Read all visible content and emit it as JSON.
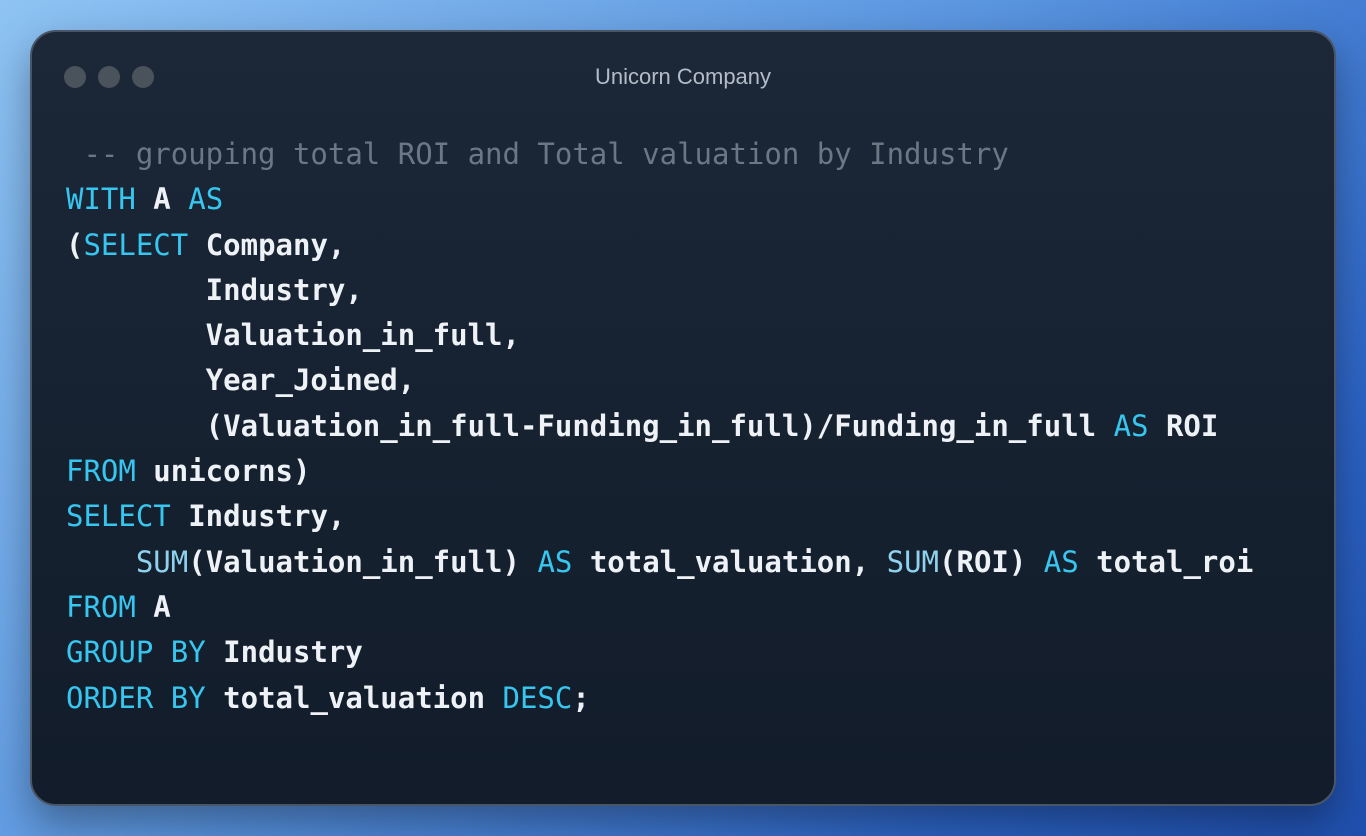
{
  "window": {
    "title": "Unicorn Company",
    "controls": [
      "close-dot",
      "minimize-dot",
      "zoom-dot"
    ]
  },
  "colors": {
    "keyword": "#36c6ef",
    "function": "#8fd2ee",
    "comment": "#6c7784",
    "identifier": "#eef2f7",
    "window_bg": "#172332"
  },
  "code": {
    "language": "sql",
    "lines": [
      [
        {
          "t": " -- grouping total ROI and Total valuation by Industry",
          "k": "cm"
        }
      ],
      [
        {
          "t": "WITH",
          "k": "kw"
        },
        {
          "t": " A ",
          "k": "id"
        },
        {
          "t": "AS",
          "k": "kw"
        }
      ],
      [
        {
          "t": "(",
          "k": "id"
        },
        {
          "t": "SELECT",
          "k": "kw"
        },
        {
          "t": " Company,",
          "k": "id"
        }
      ],
      [
        {
          "t": "        Industry,",
          "k": "id"
        }
      ],
      [
        {
          "t": "        Valuation_in_full,",
          "k": "id"
        }
      ],
      [
        {
          "t": "        Year_Joined,",
          "k": "id"
        }
      ],
      [
        {
          "t": "        (Valuation_in_full-Funding_in_full)/Funding_in_full ",
          "k": "id"
        },
        {
          "t": "AS",
          "k": "kw"
        },
        {
          "t": " ROI",
          "k": "id"
        }
      ],
      [
        {
          "t": "FROM",
          "k": "kw"
        },
        {
          "t": " unicorns)",
          "k": "id"
        }
      ],
      [
        {
          "t": "SELECT",
          "k": "kw"
        },
        {
          "t": " Industry,",
          "k": "id"
        }
      ],
      [
        {
          "t": "    ",
          "k": "id"
        },
        {
          "t": "SUM",
          "k": "fn"
        },
        {
          "t": "(Valuation_in_full) ",
          "k": "id"
        },
        {
          "t": "AS",
          "k": "kw"
        },
        {
          "t": " total_valuation, ",
          "k": "id"
        },
        {
          "t": "SUM",
          "k": "fn"
        },
        {
          "t": "(ROI) ",
          "k": "id"
        },
        {
          "t": "AS",
          "k": "kw"
        },
        {
          "t": " total_roi",
          "k": "id"
        }
      ],
      [
        {
          "t": "FROM",
          "k": "kw"
        },
        {
          "t": " A",
          "k": "id"
        }
      ],
      [
        {
          "t": "GROUP BY",
          "k": "kw"
        },
        {
          "t": " Industry",
          "k": "id"
        }
      ],
      [
        {
          "t": "ORDER BY",
          "k": "kw"
        },
        {
          "t": " total_valuation ",
          "k": "id"
        },
        {
          "t": "DESC",
          "k": "kw"
        },
        {
          "t": ";",
          "k": "id"
        }
      ]
    ]
  }
}
